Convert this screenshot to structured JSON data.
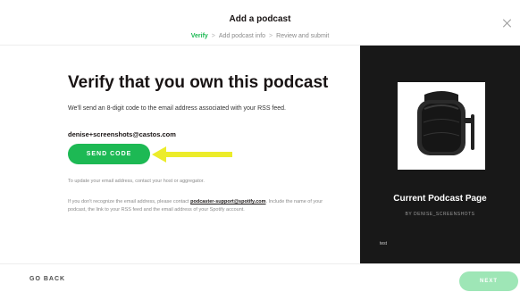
{
  "header": {
    "title": "Add a podcast",
    "steps": [
      "Verify",
      "Add podcast info",
      "Review and submit"
    ],
    "separator": ">"
  },
  "main": {
    "heading": "Verify that you own this podcast",
    "description": "We'll send an 8-digit code to the email address associated with your RSS feed.",
    "email": "denise+screenshots@castos.com",
    "send_code_label": "SEND CODE",
    "update_note": "To update your email address, contact your host or aggregator.",
    "support_prefix": "If you don't recognize the email address, please contact ",
    "support_link": "podcaster-support@spotify.com",
    "support_suffix": ". Include the name of your podcast, the link to your RSS feed and the email address of your Spotify account."
  },
  "preview": {
    "title": "Current Podcast Page",
    "subtitle": "BY DENISE_SCREENSHOTS",
    "text": "test"
  },
  "footer": {
    "back_label": "GO BACK",
    "next_label": "NEXT"
  },
  "colors": {
    "accent": "#1db954",
    "accent_disabled": "#9ee6b6",
    "preview_bg": "#181818",
    "arrow": "#ecec2a"
  },
  "icons": [
    "close-icon",
    "arrow-pointer-icon"
  ]
}
